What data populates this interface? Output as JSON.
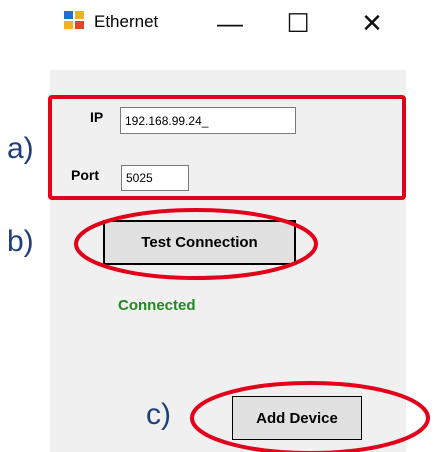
{
  "window": {
    "title": "Ethernet",
    "minimize_glyph": "—",
    "maximize_glyph": "☐",
    "close_glyph": "✕"
  },
  "form": {
    "ip_label": "IP",
    "ip_value": "192.168.99.24_",
    "port_label": "Port",
    "port_value": "5025",
    "test_button": "Test Connection",
    "status_text": "Connected",
    "add_button": "Add Device"
  },
  "annotations": {
    "a": "a)",
    "b": "b)",
    "c": "c)"
  },
  "colors": {
    "annotation_red": "#e2001a",
    "annotation_text": "#1f3f7a",
    "status_green": "#1f8a1f"
  },
  "icons": {
    "app": "window-app-icon"
  }
}
